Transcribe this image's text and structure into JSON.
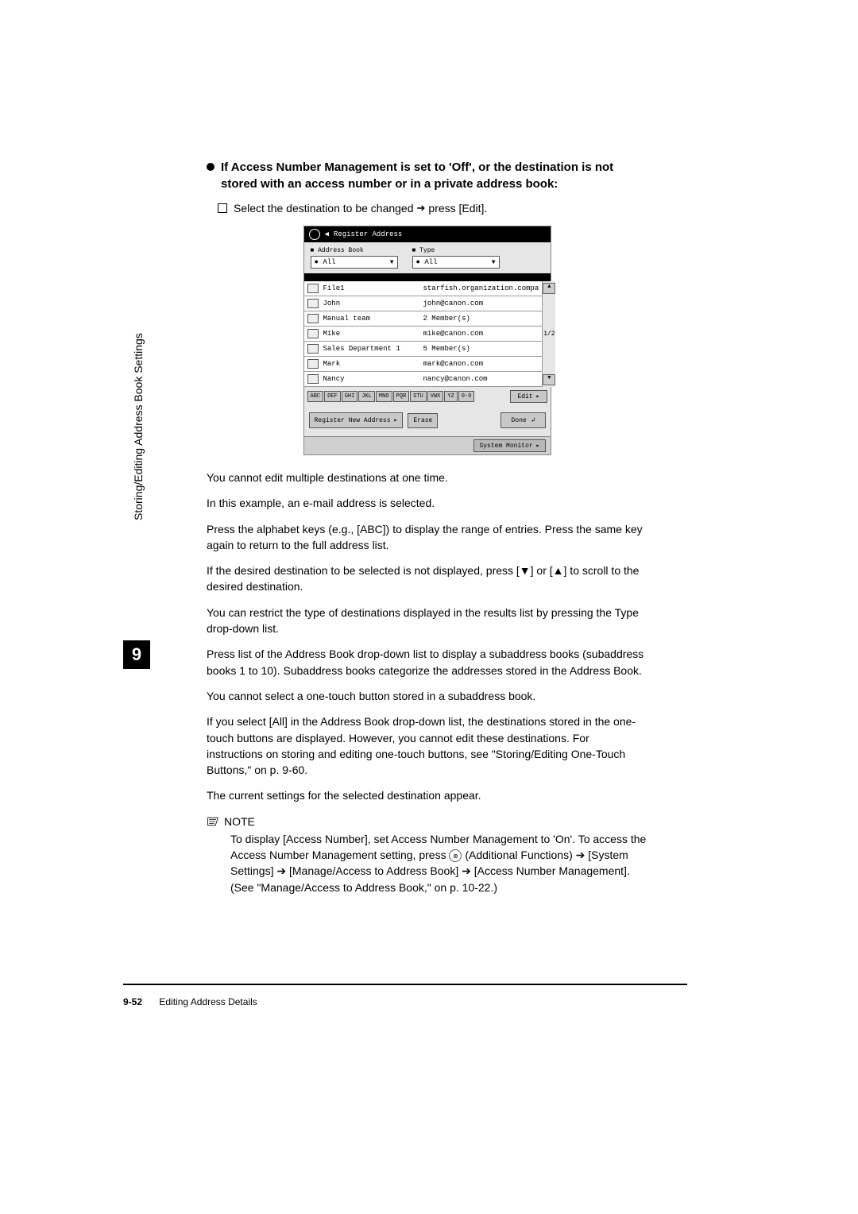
{
  "side": {
    "label": "Storing/Editing Address Book Settings",
    "chapter": "9"
  },
  "heading": "If Access Number Management is set to 'Off', or the destination is not stored with an access number or in a private address book:",
  "sub_instruction": {
    "pre": "Select the destination to be changed",
    "post": "press [Edit]."
  },
  "shot": {
    "title": "Register Address",
    "dropdowns": {
      "book_label": "Address Book",
      "book_value": "All",
      "type_label": "Type",
      "type_value": "All"
    },
    "rows": [
      {
        "name": "File1",
        "dest": "starfish.organization.compa"
      },
      {
        "name": "John",
        "dest": "john@canon.com"
      },
      {
        "name": "Manual team",
        "dest": "2 Member(s)"
      },
      {
        "name": "Mike",
        "dest": "mike@canon.com"
      },
      {
        "name": "Sales Department 1",
        "dest": "5 Member(s)"
      },
      {
        "name": "Mark",
        "dest": "mark@canon.com"
      },
      {
        "name": "Nancy",
        "dest": "nancy@canon.com"
      }
    ],
    "page_indicator": "1/2",
    "alpha": [
      "ABC",
      "DEF",
      "GHI",
      "JKL",
      "MNO",
      "PQR",
      "STU",
      "VWX",
      "YZ",
      "0-9"
    ],
    "edit": "Edit",
    "register_new": "Register New Address",
    "erase": "Erase",
    "done": "Done",
    "system_monitor": "System Monitor"
  },
  "paras": {
    "p1": "You cannot edit multiple destinations at one time.",
    "p2": "In this example, an e-mail address is selected.",
    "p3": "Press the alphabet keys (e.g., [ABC]) to display the range of entries. Press the same key again to return to the full address list.",
    "p4_a": "If the desired destination to be selected is not displayed, press [",
    "p4_b": "] or [",
    "p4_c": "] to scroll to the desired destination.",
    "p5": "You can restrict the type of destinations displayed in the results list by pressing the Type drop-down list.",
    "p6": "Press list of the Address Book drop-down list to display a subaddress books (subaddress books 1 to 10). Subaddress books categorize the addresses stored in the Address Book.",
    "p7": "You cannot select a one-touch button stored in a subaddress book.",
    "p8": "If you select [All] in the Address Book drop-down list, the destinations stored in the one-touch buttons are displayed. However, you cannot edit these destinations. For instructions on storing and editing one-touch buttons, see \"Storing/Editing One-Touch Buttons,\" on p. 9-60.",
    "p9": "The current settings for the selected destination appear."
  },
  "note": {
    "label": "NOTE",
    "body_a": "To display [Access Number], set Access Number Management to 'On'. To access the Access Number Management setting, press ",
    "body_af": " (Additional Functions) ",
    "body_b": " [System Settings] ",
    "body_c": " [Manage/Access to Address Book] ",
    "body_d": " [Access Number Management]. (See \"Manage/Access to Address Book,\" on p. 10-22.)",
    "circle_glyph": "⊛"
  },
  "footer": {
    "page": "9-52",
    "title": "Editing Address Details"
  }
}
